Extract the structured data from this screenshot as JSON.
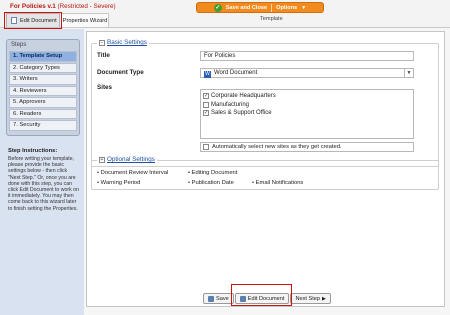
{
  "header": {
    "doc_title": "For Policies v.1",
    "restriction": "(Restricted - Severe)",
    "save_close_label": "Save and Close",
    "options_label": "Options",
    "template_label": "Template",
    "tabs": [
      {
        "label": "Edit Document"
      },
      {
        "label": "Properties Wizard"
      }
    ]
  },
  "sidebar": {
    "steps_header": "Steps",
    "steps": [
      {
        "label": "1. Template Setup",
        "active": true
      },
      {
        "label": "2. Category Types"
      },
      {
        "label": "3. Writers"
      },
      {
        "label": "4. Reviewers"
      },
      {
        "label": "5. Approvers"
      },
      {
        "label": "6. Readers"
      },
      {
        "label": "7. Security"
      }
    ],
    "instructions_title": "Step Instructions:",
    "instructions_text": "Before writing your template, please provide the basic settings below - then click \"Next Step.\" Or, once you are done with this step, you can click Edit Document to work on it immediately. You may then come back to this wizard later to finish setting the Properties."
  },
  "basic_settings": {
    "legend": "Basic Settings",
    "title_label": "Title",
    "title_value": "For Policies",
    "doc_type_label": "Document Type",
    "doc_type_value": "Word Document",
    "sites_label": "Sites",
    "sites": [
      {
        "label": "Corporate Headquarters",
        "checked": true
      },
      {
        "label": "Manufacturing",
        "checked": false
      },
      {
        "label": "Sales & Support Office",
        "checked": true
      }
    ],
    "auto_select_label": "Automatically select new sites as they get created."
  },
  "optional_settings": {
    "legend": "Optional Settings",
    "items": [
      "Document Review Interval",
      "Editing Document",
      "Warning Period",
      "Publication Date",
      "Email Notifications"
    ]
  },
  "footer": {
    "save_label": "Save",
    "edit_document_label": "Edit Document",
    "next_step_label": "Next Step"
  },
  "colors": {
    "accent_orange": "#f28a1e",
    "title_red": "#b8170f",
    "link_blue": "#1f4fa3",
    "highlight_red": "#cc1111"
  }
}
